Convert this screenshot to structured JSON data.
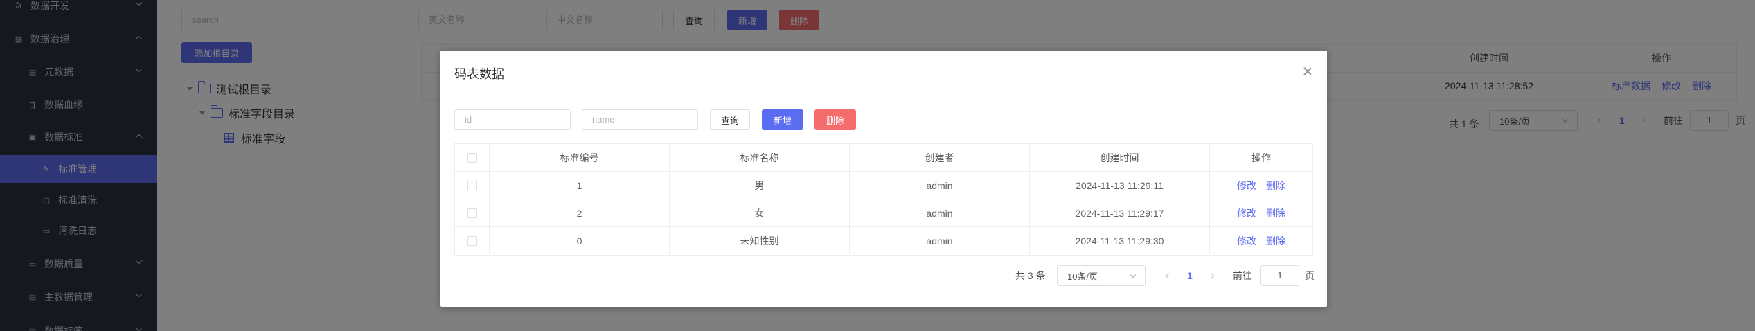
{
  "sidebar": {
    "items": [
      {
        "label": "数据开发",
        "icon": "fx-icon"
      },
      {
        "label": "数据治理",
        "icon": "grid-icon"
      },
      {
        "label": "元数据",
        "icon": "doc-icon"
      },
      {
        "label": "数据血缘",
        "icon": "lineage-icon"
      },
      {
        "label": "数据标准",
        "icon": "standard-icon"
      },
      {
        "label": "标准管理",
        "icon": "edit-icon"
      },
      {
        "label": "标准清洗",
        "icon": "clean-icon"
      },
      {
        "label": "清洗日志",
        "icon": "log-icon"
      },
      {
        "label": "数据质量",
        "icon": "quality-icon"
      },
      {
        "label": "主数据管理",
        "icon": "master-icon"
      },
      {
        "label": "数据标签",
        "icon": "tag-icon"
      }
    ],
    "fx": "fx"
  },
  "toolbar": {
    "search_placeholder": "search",
    "en_name_placeholder": "英文名称",
    "cn_name_placeholder": "中文名称",
    "query_label": "查询",
    "add_label": "新增",
    "delete_label": "删除",
    "add_root_label": "添加根目录"
  },
  "tree": {
    "root": "测试根目录",
    "child": "标准字段目录",
    "leaf": "标准字段"
  },
  "bg_table": {
    "headers": [
      "创建时间",
      "操作"
    ],
    "row": {
      "time": "2024-11-13 11:28:52",
      "ops": [
        "标准数据",
        "修改",
        "删除"
      ]
    }
  },
  "bg_pager": {
    "total": "共 1 条",
    "page_size": "10条/页",
    "current": "1",
    "goto": "前往",
    "page_input": "1",
    "page_unit": "页"
  },
  "dialog": {
    "title": "码表数据",
    "id_placeholder": "id",
    "name_placeholder": "name",
    "query_label": "查询",
    "add_label": "新增",
    "delete_label": "删除",
    "headers": [
      "标准编号",
      "标准名称",
      "创建者",
      "创建时间",
      "操作"
    ],
    "rows": [
      {
        "code": "1",
        "name": "男",
        "creator": "admin",
        "time": "2024-11-13 11:29:11",
        "edit": "修改",
        "del": "删除"
      },
      {
        "code": "2",
        "name": "女",
        "creator": "admin",
        "time": "2024-11-13 11:29:17",
        "edit": "修改",
        "del": "删除"
      },
      {
        "code": "0",
        "name": "未知性别",
        "creator": "admin",
        "time": "2024-11-13 11:29:30",
        "edit": "修改",
        "del": "删除"
      }
    ],
    "pager": {
      "total": "共 3 条",
      "page_size": "10条/页",
      "current": "1",
      "goto": "前往",
      "page_input": "1",
      "page_unit": "页"
    }
  },
  "colors": {
    "accent": "#5c6cf0",
    "danger": "#f56c6c",
    "sidebar": "#2a313c"
  }
}
